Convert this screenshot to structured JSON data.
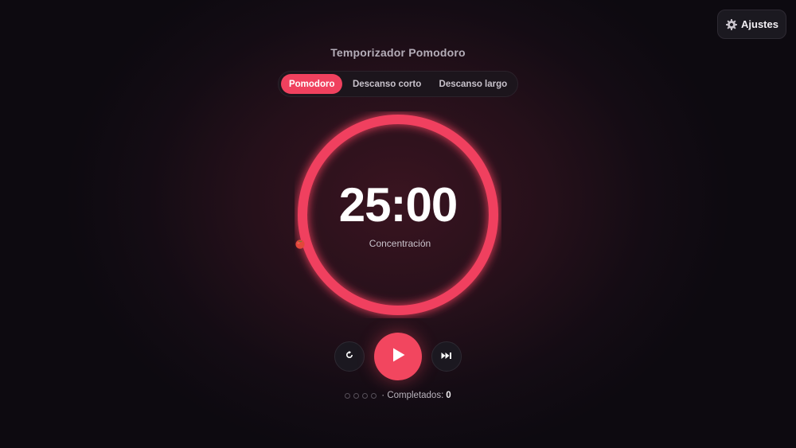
{
  "settings": {
    "label": "Ajustes",
    "icon": "gear-icon"
  },
  "app": {
    "title": "Temporizador Pomodoro"
  },
  "tabs": [
    {
      "label": "Pomodoro",
      "active": true
    },
    {
      "label": "Descanso corto",
      "active": false
    },
    {
      "label": "Descanso largo",
      "active": false
    }
  ],
  "timer": {
    "time": "25:00",
    "phase_label": "Concentración",
    "phase_icon": "tomato-icon",
    "progress": 1.0,
    "accent_color": "#f0415e"
  },
  "controls": {
    "reset_icon": "reset-icon",
    "play_icon": "play-icon",
    "skip_icon": "skip-icon"
  },
  "session": {
    "dots_total": 4,
    "dots_filled": 0,
    "completed_prefix": "· Completados:",
    "completed_count": "0"
  }
}
